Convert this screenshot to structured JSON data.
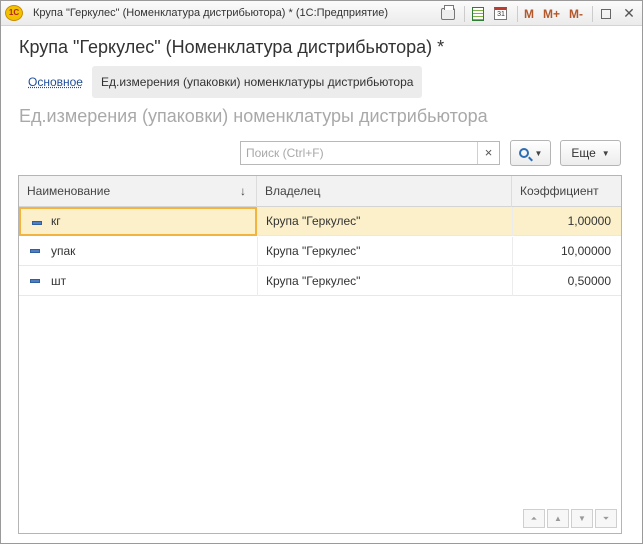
{
  "window": {
    "title": "Крупа \"Геркулес\" (Номенклатура дистрибьютора) *  (1С:Предприятие)",
    "logo_text": "1С",
    "memory_buttons": [
      "M",
      "M+",
      "M-"
    ]
  },
  "form": {
    "title": "Крупа \"Геркулес\" (Номенклатура дистрибьютора) *",
    "tabs": [
      {
        "label": "Основное"
      },
      {
        "label": "Ед.измерения (упаковки)  номенклатуры дистрибьютора"
      }
    ],
    "section_title": "Ед.измерения (упаковки)  номенклатуры дистрибьютора"
  },
  "toolbar": {
    "search_placeholder": "Поиск (Ctrl+F)",
    "search_value": "",
    "clear_label": "×",
    "more_label": "Еще"
  },
  "table": {
    "columns": [
      "Наименование",
      "Владелец",
      "Коэффициент"
    ],
    "sort_indicator": "↓",
    "rows": [
      {
        "name": "кг",
        "owner": "Крупа \"Геркулес\"",
        "coef": "1,00000",
        "selected": true
      },
      {
        "name": "упак",
        "owner": "Крупа \"Геркулес\"",
        "coef": "10,00000",
        "selected": false
      },
      {
        "name": "шт",
        "owner": "Крупа \"Геркулес\"",
        "coef": "0,50000",
        "selected": false
      }
    ]
  },
  "icons": {
    "row_icon": "catalog-item-icon",
    "nav": [
      "first-icon",
      "up-icon",
      "down-icon",
      "last-icon"
    ]
  },
  "colors": {
    "selected_row": "#fbf0c9",
    "selected_cell_border": "#f3b43f",
    "link": "#1f4e99"
  }
}
